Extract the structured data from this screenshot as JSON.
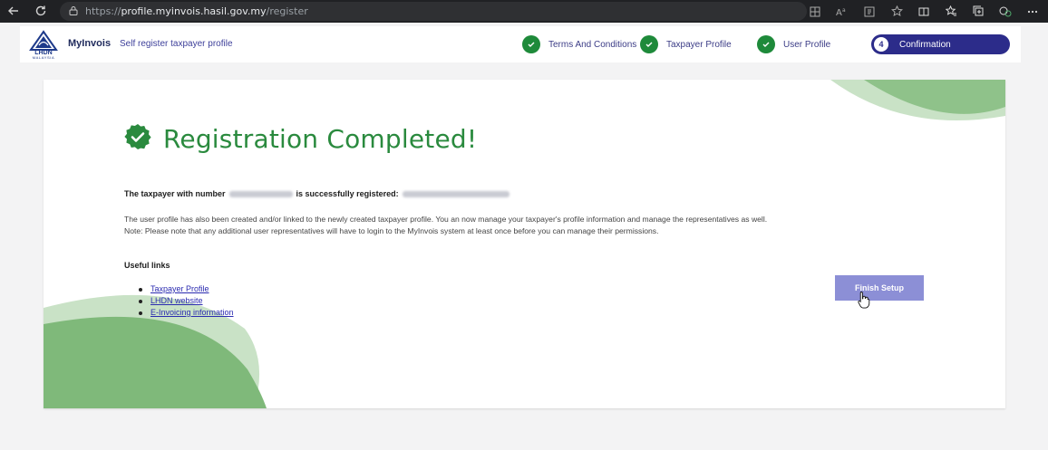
{
  "browser": {
    "url_prefix": "https://",
    "url_host": "profile.myinvois.hasil.gov.my",
    "url_path": "/register"
  },
  "header": {
    "logo_text": "LHDN",
    "logo_subtext": "MALAYSIA",
    "brand": "MyInvois",
    "subtitle": "Self register taxpayer profile"
  },
  "steps": [
    {
      "label": "Terms And Conditions",
      "status": "done"
    },
    {
      "label": "Taxpayer Profile",
      "status": "done"
    },
    {
      "label": "User Profile",
      "status": "done"
    },
    {
      "label": "Confirmation",
      "status": "active",
      "number": "4"
    }
  ],
  "main": {
    "title": "Registration Completed!",
    "reg_prefix": "The taxpayer with number",
    "reg_middle": "is successfully registered:",
    "para_line1": "The user profile has also been created and/or linked to the newly created taxpayer profile. You an now manage your taxpayer's profile information and manage the representatives as well.",
    "para_line2": "Note: Please note that any additional user representatives will have to login to the MyInvois system at least once before you can manage their permissions.",
    "useful_links_heading": "Useful links",
    "links": [
      "Taxpayer Profile",
      "LHDN website",
      "E-Invoicing information"
    ],
    "finish_button": "Finish Setup"
  },
  "colors": {
    "accent_green": "#2a8a3e",
    "step_done": "#1e8a3a",
    "step_active": "#2c2c8a",
    "button": "#8c8fd6",
    "link": "#2b2bb0"
  }
}
